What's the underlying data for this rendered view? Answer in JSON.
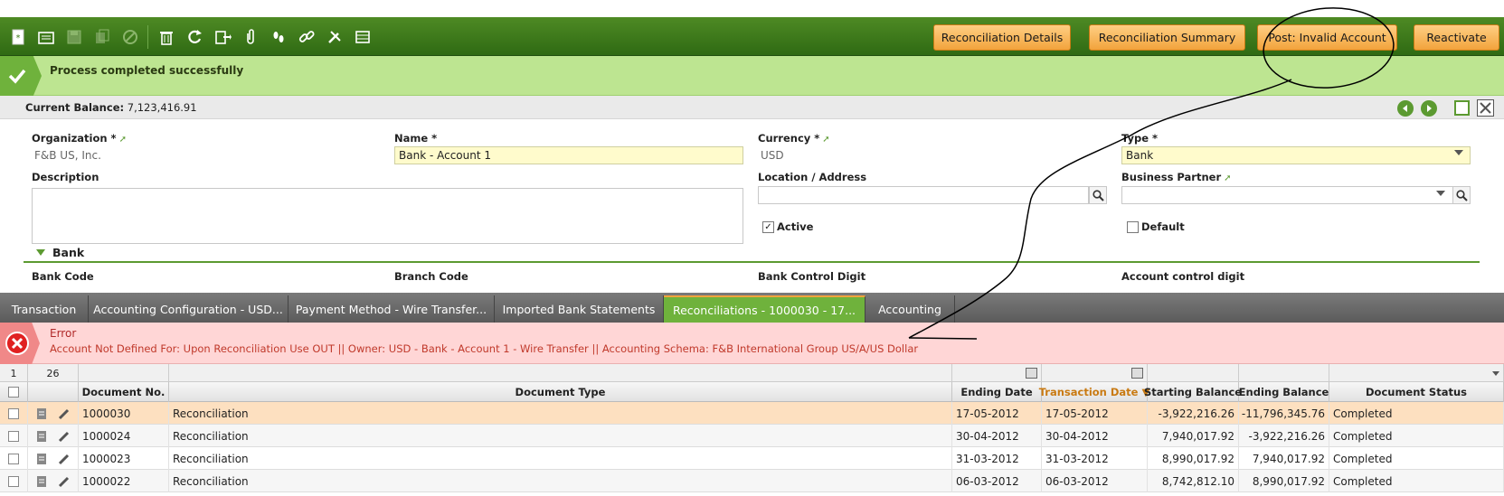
{
  "toolbar": {
    "icons": [
      "new-icon",
      "new-doc-icon",
      "save-icon",
      "copy-icon",
      "undo-icon",
      "delete-icon",
      "refresh-icon",
      "export-icon",
      "attach-icon",
      "footprints-icon",
      "link-icon",
      "tools-icon",
      "grid-icon"
    ],
    "buttons": {
      "details": "Reconciliation Details",
      "summary": "Reconciliation Summary",
      "post": "Post: Invalid Account",
      "reactivate": "Reactivate"
    },
    "accent": "#f2a33c",
    "bar_color": "#3f7a1b"
  },
  "success": {
    "message": "Process completed successfully"
  },
  "header": {
    "balance_label": "Current Balance:",
    "balance_value": "7,123,416.91"
  },
  "form": {
    "organization": {
      "label": "Organization *",
      "value": "F&B US, Inc."
    },
    "name": {
      "label": "Name *",
      "value": "Bank - Account 1"
    },
    "currency": {
      "label": "Currency *",
      "value": "USD"
    },
    "type": {
      "label": "Type *",
      "value": "Bank"
    },
    "description": {
      "label": "Description",
      "value": ""
    },
    "location": {
      "label": "Location / Address",
      "value": ""
    },
    "business_partner": {
      "label": "Business Partner",
      "value": ""
    },
    "active": {
      "label": "Active",
      "checked": true
    },
    "default": {
      "label": "Default",
      "checked": false
    },
    "section": "Bank",
    "bank_code": "Bank Code",
    "branch_code": "Branch Code",
    "bank_control_digit": "Bank Control Digit",
    "account_control_digit": "Account control digit"
  },
  "tabs": [
    "Transaction",
    "Accounting Configuration - USD...",
    "Payment Method - Wire Transfer...",
    "Imported Bank Statements",
    "Reconciliations - 1000030 - 17...",
    "Accounting"
  ],
  "error": {
    "title": "Error",
    "message": "Account Not Defined For: Upon Reconciliation Use OUT || Owner: USD - Bank - Account 1 - Wire Transfer || Accounting Schema: F&B International Group US/A/US Dollar"
  },
  "grid": {
    "position": "1",
    "count": "26",
    "columns": [
      "Document No.",
      "Document Type",
      "Ending Date",
      "Transaction Date ▼",
      "Starting Balance",
      "Ending Balance",
      "Document Status"
    ],
    "rows": [
      [
        "1000030",
        "Reconciliation",
        "17-05-2012",
        "17-05-2012",
        "-3,922,216.26",
        "-11,796,345.76",
        "Completed"
      ],
      [
        "1000024",
        "Reconciliation",
        "30-04-2012",
        "30-04-2012",
        "7,940,017.92",
        "-3,922,216.26",
        "Completed"
      ],
      [
        "1000023",
        "Reconciliation",
        "31-03-2012",
        "31-03-2012",
        "8,990,017.92",
        "7,940,017.92",
        "Completed"
      ],
      [
        "1000022",
        "Reconciliation",
        "06-03-2012",
        "06-03-2012",
        "8,742,812.10",
        "8,990,017.92",
        "Completed"
      ]
    ]
  },
  "colors": {
    "success_bg": "#bde591",
    "error_bg": "#ffd6d6",
    "tab_active": "#6fb23c",
    "selected_row": "#fde0c0"
  }
}
